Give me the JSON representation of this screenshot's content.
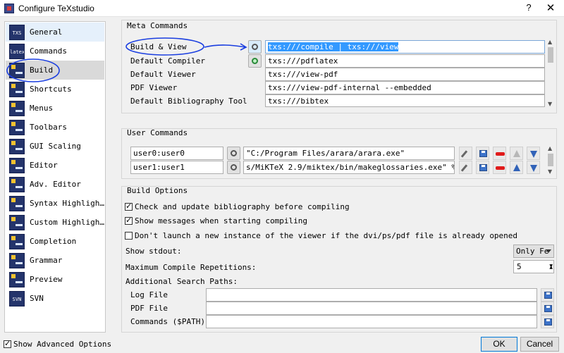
{
  "window": {
    "title": "Configure TeXstudio",
    "help_label": "?",
    "close_label": "✕"
  },
  "sidebar": {
    "items": [
      {
        "label": "General",
        "icon": "texs-general-icon",
        "icon_text": "TXS"
      },
      {
        "label": "Commands",
        "icon": "latex-commands-icon",
        "icon_text": "latex"
      },
      {
        "label": "Build",
        "icon": "build-icon",
        "icon_text": ""
      },
      {
        "label": "Shortcuts",
        "icon": "shortcuts-icon",
        "icon_text": ""
      },
      {
        "label": "Menus",
        "icon": "menus-icon",
        "icon_text": ""
      },
      {
        "label": "Toolbars",
        "icon": "toolbars-icon",
        "icon_text": ""
      },
      {
        "label": "GUI Scaling",
        "icon": "gui-scaling-icon",
        "icon_text": ""
      },
      {
        "label": "Editor",
        "icon": "editor-icon",
        "icon_text": ""
      },
      {
        "label": "Adv. Editor",
        "icon": "adv-editor-icon",
        "icon_text": ""
      },
      {
        "label": "Syntax Highligh…",
        "icon": "syntax-highlighting-icon",
        "icon_text": ""
      },
      {
        "label": "Custom Highligh…",
        "icon": "custom-highlighting-icon",
        "icon_text": ""
      },
      {
        "label": "Completion",
        "icon": "completion-icon",
        "icon_text": ""
      },
      {
        "label": "Grammar",
        "icon": "grammar-icon",
        "icon_text": ""
      },
      {
        "label": "Preview",
        "icon": "preview-icon",
        "icon_text": ""
      },
      {
        "label": "SVN",
        "icon": "svn-icon",
        "icon_text": "SVN"
      }
    ],
    "selected": "Build"
  },
  "meta_commands": {
    "title": "Meta Commands",
    "rows": [
      {
        "label": "Build & View",
        "value": "txs:///compile | txs:///view"
      },
      {
        "label": "Default Compiler",
        "value": "txs:///pdflatex"
      },
      {
        "label": "Default Viewer",
        "value": "txs:///view-pdf"
      },
      {
        "label": "PDF Viewer",
        "value": "txs:///view-pdf-internal --embedded"
      },
      {
        "label": "Default Bibliography Tool",
        "value": "txs:///bibtex"
      }
    ]
  },
  "user_commands": {
    "title": "User Commands",
    "rows": [
      {
        "name": "user0:user0",
        "command": "\"C:/Program Files/arara/arara.exe\""
      },
      {
        "name": "user1:user1",
        "command": "s/MiKTeX 2.9/miktex/bin/makeglossaries.exe\"  %"
      }
    ]
  },
  "build_options": {
    "title": "Build Options",
    "checkboxes": [
      {
        "label": "Check and update bibliography before compiling",
        "checked": true
      },
      {
        "label": "Show messages when starting compiling",
        "checked": true
      },
      {
        "label": "Don't launch a new instance of the viewer if the dvi/ps/pdf file is already opened",
        "checked": false
      }
    ],
    "show_stdout_label": "Show stdout:",
    "show_stdout_value": "Only Fe",
    "max_repetitions_label": "Maximum Compile Repetitions:",
    "max_repetitions_value": "5",
    "search_paths_label": "Additional Search Paths:",
    "paths": [
      {
        "label": "Log File",
        "value": ""
      },
      {
        "label": "PDF File",
        "value": ""
      },
      {
        "label": "Commands ($PATH)",
        "value": ""
      }
    ]
  },
  "footer": {
    "show_advanced_label": "Show Advanced Options",
    "show_advanced_checked": true,
    "ok_label": "OK",
    "cancel_label": "Cancel"
  },
  "colors": {
    "selection": "#3399ff",
    "annotation": "#1a3ee0",
    "accent": "#0078d7"
  }
}
